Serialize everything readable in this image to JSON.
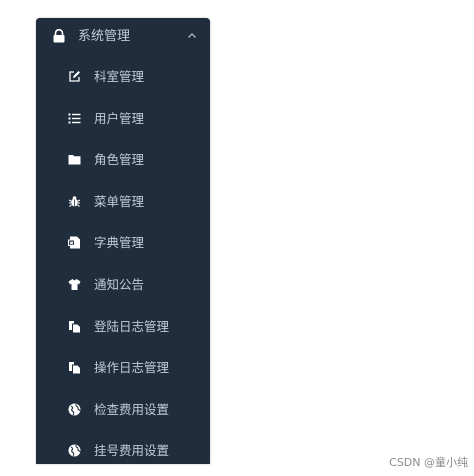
{
  "colors": {
    "menu_bg": "#1f2d3d",
    "text": "#bfcbd9",
    "icon": "#ffffff"
  },
  "menu": {
    "header": {
      "label": "系统管理",
      "icon": "lock-icon",
      "expanded": true
    },
    "items": [
      {
        "label": "科室管理",
        "icon": "edit-icon"
      },
      {
        "label": "用户管理",
        "icon": "list-icon"
      },
      {
        "label": "角色管理",
        "icon": "folder-icon"
      },
      {
        "label": "菜单管理",
        "icon": "bug-icon"
      },
      {
        "label": "字典管理",
        "icon": "document-icon"
      },
      {
        "label": "通知公告",
        "icon": "shirt-icon"
      },
      {
        "label": "登陆日志管理",
        "icon": "copy-icon"
      },
      {
        "label": "操作日志管理",
        "icon": "copy-icon"
      },
      {
        "label": "检查费用设置",
        "icon": "globe-icon"
      },
      {
        "label": "挂号费用设置",
        "icon": "globe-icon"
      }
    ]
  },
  "watermark": "CSDN @童小纯"
}
